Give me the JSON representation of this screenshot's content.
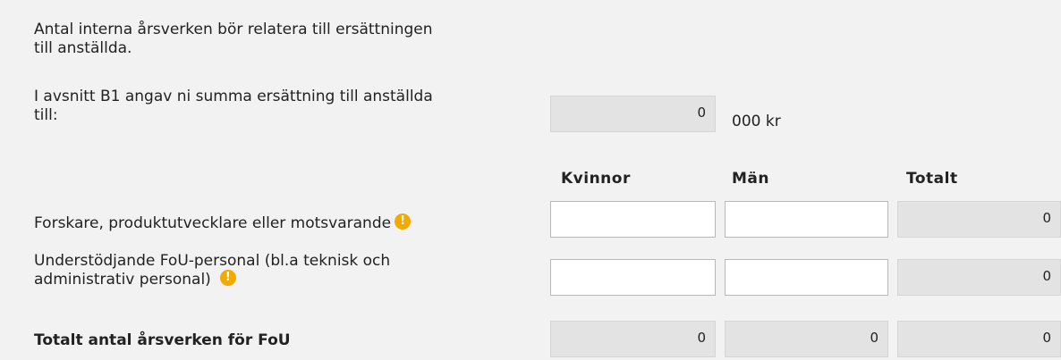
{
  "intro": {
    "line1": "Antal interna årsverken bör relatera till ersättningen",
    "line2": "till anställda."
  },
  "b1": {
    "line1": "I avsnitt B1 angav ni summa ersättning till anställda",
    "line2": "till:",
    "value": "0",
    "unit": "000 kr"
  },
  "columns": {
    "women": "Kvinnor",
    "men": "Män",
    "total": "Totalt"
  },
  "rows": [
    {
      "label_line1": "Forskare, produktutvecklare eller motsvarande",
      "women": "",
      "men": "",
      "total": "0",
      "info_icon": "info-icon"
    },
    {
      "label_line1": "Understödjande FoU-personal (bl.a teknisk och",
      "label_line2": "administrativ personal)",
      "women": "",
      "men": "",
      "total": "0",
      "info_icon": "info-icon"
    }
  ],
  "totals": {
    "label": "Totalt antal årsverken för FoU",
    "women": "0",
    "men": "0",
    "total": "0"
  },
  "colors": {
    "background": "#f2f2f2",
    "readonly_field": "#e3e3e3",
    "info_icon": "#f2a900"
  }
}
